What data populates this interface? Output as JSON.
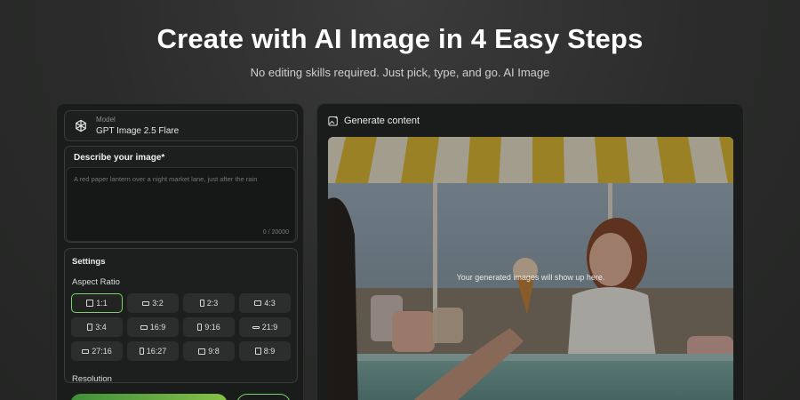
{
  "hero": {
    "title": "Create with AI Image in 4 Easy Steps",
    "subtitle": "No editing skills required. Just pick, type, and go. AI Image"
  },
  "model": {
    "label": "Model",
    "name": "GPT Image 2.5 Flare",
    "icon": "openai-logo-icon"
  },
  "prompt": {
    "title": "Describe your image*",
    "placeholder": "A red paper lantern over a night market lane, just after the rain",
    "char_count": "0 / 20000"
  },
  "settings": {
    "title": "Settings",
    "aspect_ratio_title": "Aspect Ratio",
    "selected_ratio": "1:1",
    "ratios": [
      "1:1",
      "3:2",
      "2:3",
      "4:3",
      "3:4",
      "16:9",
      "9:16",
      "21:9",
      "27:16",
      "16:27",
      "9:8",
      "8:9"
    ],
    "resolution_title": "Resolution"
  },
  "output": {
    "header": "Generate content",
    "header_icon": "image-sparkle-icon",
    "hint": "Your generated images will show up here."
  },
  "colors": {
    "accent": "#7bd16b",
    "panel": "#1a1b1b",
    "card": "#1d1e1e"
  }
}
